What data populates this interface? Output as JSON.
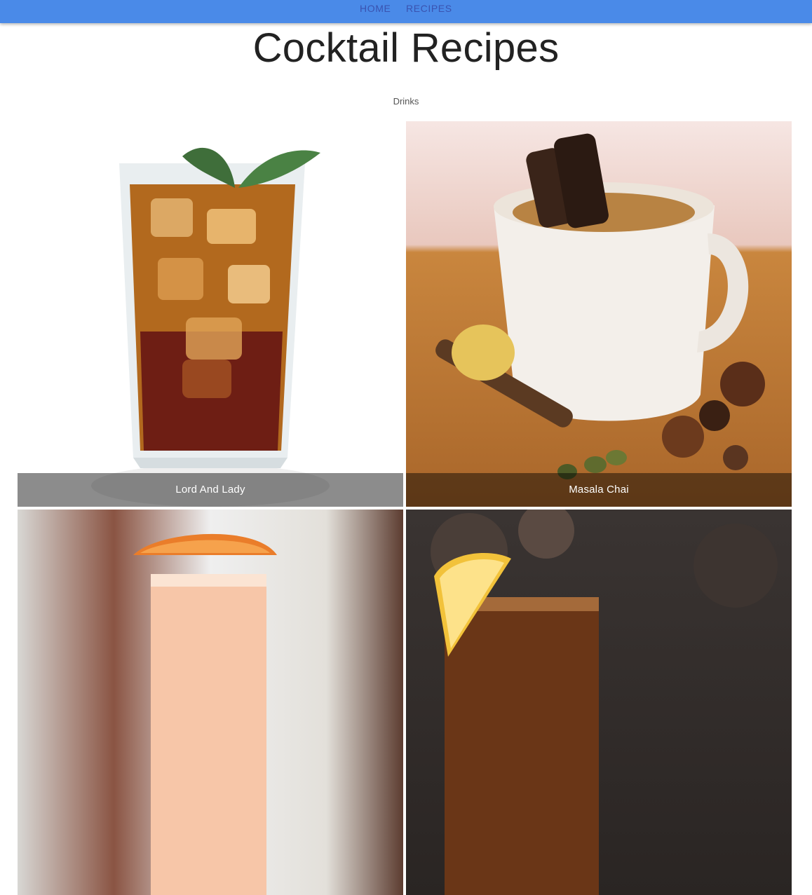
{
  "nav": {
    "home_label": "HOME",
    "recipes_label": "RECIPES"
  },
  "page": {
    "title": "Cocktail Recipes",
    "subheader": "Drinks"
  },
  "colors": {
    "appbar": "#4a8ae8",
    "nav_text": "#3a53b0",
    "tile_bar": "rgba(0,0,0,0.45)"
  },
  "recipes": [
    {
      "name": "Lord And Lady",
      "image_icon": "iced-drink-glass-icon"
    },
    {
      "name": "Masala Chai",
      "image_icon": "tea-mug-icon"
    },
    {
      "name": "",
      "image_icon": "orange-cocktail-icon"
    },
    {
      "name": "",
      "image_icon": "whiskey-lemon-icon"
    }
  ]
}
